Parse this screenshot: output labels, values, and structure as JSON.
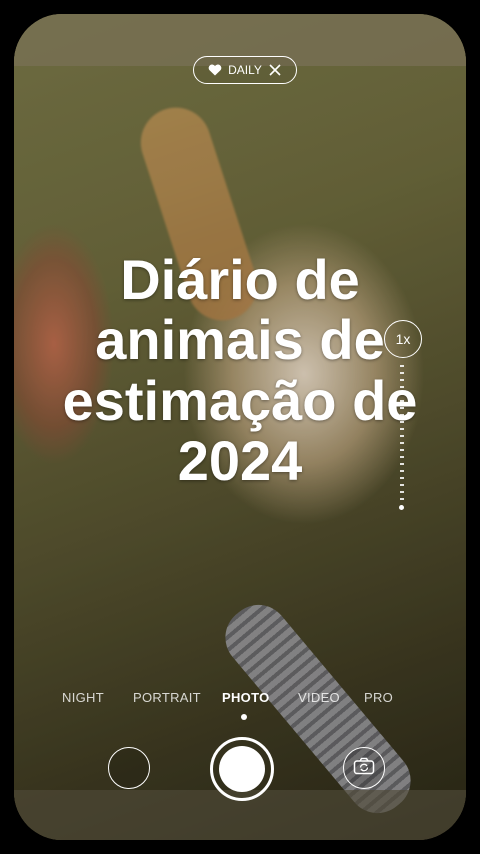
{
  "badge": {
    "label": "DAILY",
    "icon_left": "heart-icon",
    "icon_right": "close-icon"
  },
  "title": {
    "line1": "Diário de",
    "line2": "animais de",
    "line3": "estimação de",
    "line4": "2024"
  },
  "zoom": {
    "label": "1x"
  },
  "modes": [
    {
      "label": "NIGHT"
    },
    {
      "label": "PORTRAIT"
    },
    {
      "label": "PHOTO",
      "active": true
    },
    {
      "label": "VIDEO"
    },
    {
      "label": "PRO"
    }
  ],
  "controls": {
    "gallery_icon": "gallery-thumbnail",
    "shutter_icon": "shutter-button",
    "flip_icon": "camera-flip-icon"
  }
}
